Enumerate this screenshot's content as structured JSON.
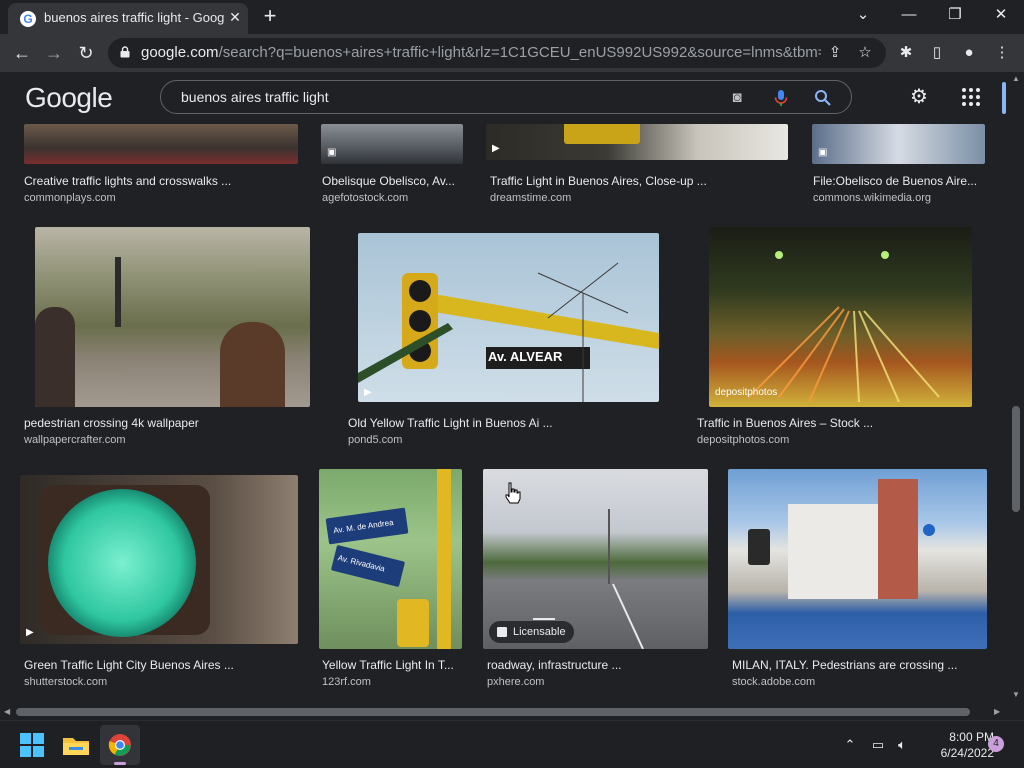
{
  "browser": {
    "tab_title": "buenos aires traffic light - Google",
    "tab_favicon": "G",
    "close_tab": "✕",
    "new_tab": "+",
    "url_domain": "google.com",
    "url_path": "/search?q=buenos+aires+traffic+light&rlz=1C1GCEU_enUS992US992&source=lnms&tbm=isc..."
  },
  "google": {
    "logo": "Google",
    "query": "buenos aires traffic light"
  },
  "results": [
    {
      "title": "Creative traffic lights and crosswalks ...",
      "source": "commonplays.com"
    },
    {
      "title": "Obelisque Obelisco, Av...",
      "source": "agefotostock.com"
    },
    {
      "title": "Traffic Light in Buenos Aires, Close-up ...",
      "source": "dreamstime.com"
    },
    {
      "title": "File:Obelisco de Buenos Aire...",
      "source": "commons.wikimedia.org"
    },
    {
      "title": "pedestrian crossing 4k wallpaper",
      "source": "wallpapercrafter.com"
    },
    {
      "title": "Old Yellow Traffic Light in Buenos Ai ...",
      "source": "pond5.com"
    },
    {
      "title": "Traffic in Buenos Aires – Stock ...",
      "source": "depositphotos.com"
    },
    {
      "title": "Green Traffic Light City Buenos Aires ...",
      "source": "shutterstock.com"
    },
    {
      "title": "Yellow Traffic Light In T...",
      "source": "123rf.com"
    },
    {
      "title": "roadway, infrastructure ...",
      "source": "pxhere.com"
    },
    {
      "title": "MILAN, ITALY. Pedestrians are crossing ...",
      "source": "stock.adobe.com"
    }
  ],
  "image_text": {
    "street_sign": "Av. ALVEAR",
    "licensable_badge": "Licensable",
    "depositphotos_mark": "depositphotos",
    "sign_upper": "Av. M. de Andrea",
    "sign_lower": "Av. Rivadavia"
  },
  "taskbar": {
    "time": "8:00 PM",
    "date": "6/24/2022",
    "notifications": "4"
  },
  "colors": {
    "background": "#202124",
    "chrome": "#35363a",
    "text": "#e8eaed",
    "muted": "#bdc1c6",
    "accent": "#8ab4f8"
  }
}
